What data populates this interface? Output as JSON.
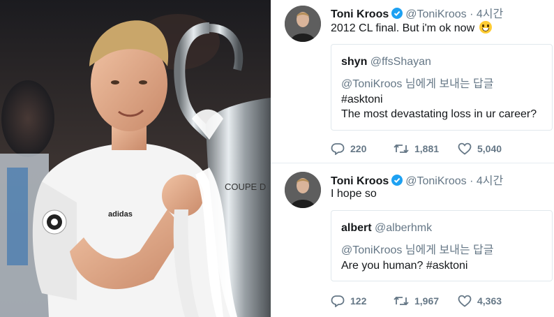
{
  "tweets": [
    {
      "author_name": "Toni Kroos",
      "author_handle": "@ToniKroos",
      "separator": "·",
      "time": "4시간",
      "text": "2012 CL final. But i'm ok now",
      "emoji": "grinning-face",
      "quote": {
        "name": "shyn",
        "handle": "@ffsShayan",
        "reply_to": "@ToniKroos 님에게 보내는 답글",
        "lines": [
          "#asktoni",
          "The most devastating loss in ur career?"
        ]
      },
      "replies": "220",
      "retweets": "1,881",
      "likes": "5,040"
    },
    {
      "author_name": "Toni Kroos",
      "author_handle": "@ToniKroos",
      "separator": "·",
      "time": "4시간",
      "text": "I hope so",
      "quote": {
        "name": "albert",
        "handle": "@alberhmk",
        "reply_to": "@ToniKroos 님에게 보내는 답글",
        "lines": [
          "Are you human? #asktoni"
        ]
      },
      "replies": "122",
      "retweets": "1,967",
      "likes": "4,363"
    }
  ],
  "photo": {
    "shirt_sponsor": "adidas",
    "trophy_text": "COUPE D"
  },
  "colors": {
    "verified": "#1da1f2",
    "muted": "#657786",
    "border": "#e1e8ed"
  }
}
